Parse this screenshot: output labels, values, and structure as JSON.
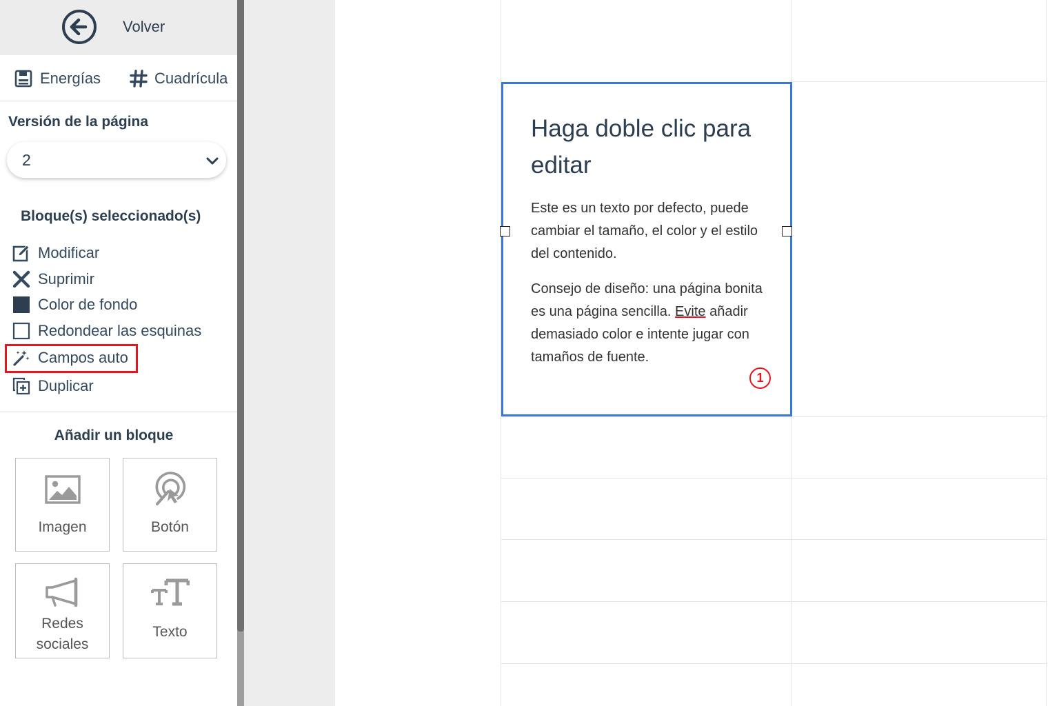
{
  "sidebar": {
    "back_label": "Volver",
    "tools": {
      "energias": "Energías",
      "cuadricula": "Cuadrícula"
    },
    "version": {
      "title": "Versión de la página",
      "selected": "2"
    },
    "blocks_title": "Bloque(s) seleccionado(s)",
    "actions": {
      "modificar": "Modificar",
      "suprimir": "Suprimir",
      "color_fondo": "Color de fondo",
      "redondear": "Redondear las esquinas",
      "campos_auto": "Campos auto",
      "duplicar": "Duplicar"
    },
    "add_title": "Añadir un bloque",
    "tiles": {
      "imagen": "Imagen",
      "boton": "Botón",
      "redes_line1": "Redes",
      "redes_line2": "sociales",
      "texto": "Texto"
    }
  },
  "canvas": {
    "heading": "Haga doble clic para editar",
    "para1": "Este es un texto por defecto, puede cambiar el tamaño, el color y el estilo del contenido.",
    "para2_before": "Consejo de diseño: una página bonita es una página sencilla. ",
    "para2_flagged": "Evite",
    "para2_after": " añadir demasiado color e intente jugar con tamaños de fuente.",
    "badge": "1"
  },
  "colors": {
    "accent_selection": "#3a78d8",
    "highlight_red": "#e8141e",
    "text_dark": "#2c3e50",
    "swatch_fill": "#2c3e50"
  }
}
